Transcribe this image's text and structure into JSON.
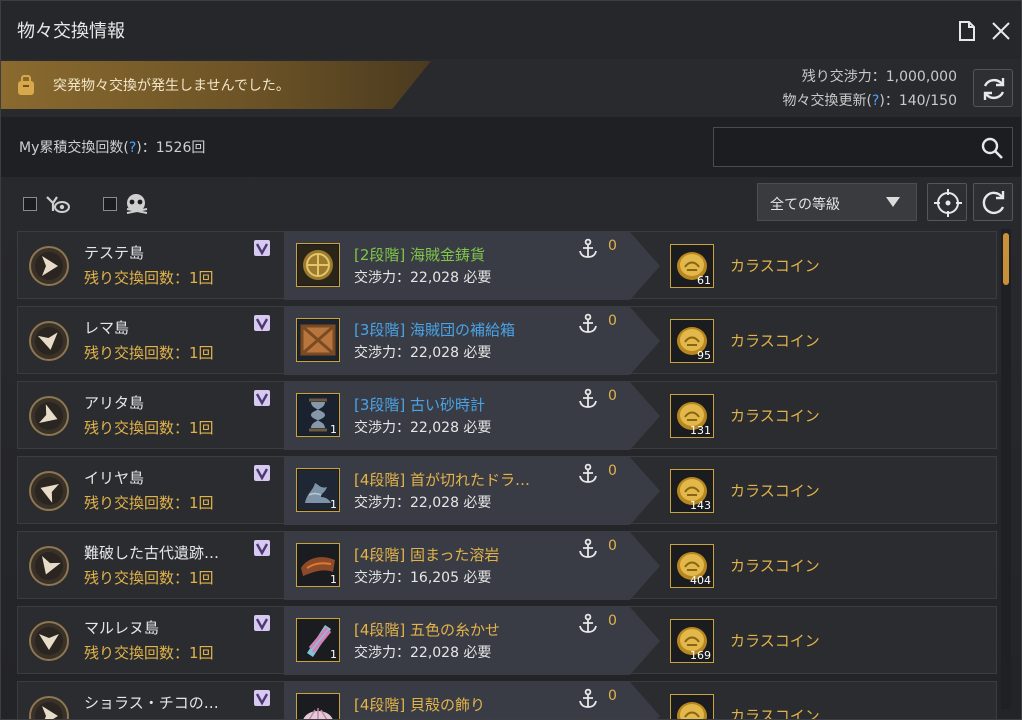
{
  "window": {
    "title": "物々交換情報",
    "banner_text": "突発物々交換が発生しませんでした。",
    "stats": {
      "remaining_power_label": "残り交渉力：",
      "remaining_power_value": "1,000,000",
      "refresh_label_pre": "物々交換更新(",
      "refresh_label_q": "?",
      "refresh_label_post": ")：",
      "refresh_value": "140/150"
    },
    "cumulative_pre": "My累積交換回数(",
    "cumulative_q": "?",
    "cumulative_post": ")：1526回",
    "search_placeholder": "",
    "grade_select": "全ての等級"
  },
  "rows": [
    {
      "island": "テステ島",
      "remaining": "残り交換回数：1回",
      "item_name": "[2段階] 海賊金鋳貨",
      "item_color": "#7fc64a",
      "cost": "交渉力：22,028 必要",
      "anchor_count": "0",
      "item_qty": "",
      "reward_name": "カラスコイン",
      "reward_qty": "61",
      "item_icon": "gold-coin-icon",
      "compass_dir": 0
    },
    {
      "island": "レマ島",
      "remaining": "残り交換回数：1回",
      "item_name": "[3段階] 海賊団の補給箱",
      "item_color": "#4aa3e6",
      "cost": "交渉力：22,028 必要",
      "anchor_count": "0",
      "item_qty": "",
      "reward_name": "カラスコイン",
      "reward_qty": "95",
      "item_icon": "crate-icon",
      "compass_dir": 80
    },
    {
      "island": "アリタ島",
      "remaining": "残り交換回数：1回",
      "item_name": "[3段階] 古い砂時計",
      "item_color": "#4aa3e6",
      "cost": "交渉力：22,028 必要",
      "anchor_count": "0",
      "item_qty": "1",
      "reward_name": "カラスコイン",
      "reward_qty": "131",
      "item_icon": "hourglass-icon",
      "compass_dir": 20
    },
    {
      "island": "イリヤ島",
      "remaining": "残り交換回数：1回",
      "item_name": "[4段階] 首が切れたドラ…",
      "item_color": "#e2b34a",
      "cost": "交渉力：22,028 必要",
      "anchor_count": "0",
      "item_qty": "1",
      "reward_name": "カラスコイン",
      "reward_qty": "143",
      "item_icon": "dragon-statue-icon",
      "compass_dir": 200
    },
    {
      "island": "難破した古代遺跡…",
      "remaining": "残り交換回数：1回",
      "item_name": "[4段階] 固まった溶岩",
      "item_color": "#e2b34a",
      "cost": "交渉力：16,205 必要",
      "anchor_count": "0",
      "item_qty": "1",
      "reward_name": "カラスコイン",
      "reward_qty": "404",
      "item_icon": "lava-rock-icon",
      "compass_dir": 110
    },
    {
      "island": "マルレヌ島",
      "remaining": "残り交換回数：1回",
      "item_name": "[4段階] 五色の糸かせ",
      "item_color": "#e2b34a",
      "cost": "交渉力：22,028 必要",
      "anchor_count": "0",
      "item_qty": "1",
      "reward_name": "カラスコイン",
      "reward_qty": "169",
      "item_icon": "thread-skein-icon",
      "compass_dir": 90
    },
    {
      "island": "ショラス・チコの…",
      "remaining": "",
      "item_name": "[4段階] 貝殻の飾り",
      "item_color": "#e2b34a",
      "cost": "",
      "anchor_count": "0",
      "item_qty": "",
      "reward_name": "カラスコイン",
      "reward_qty": "",
      "item_icon": "shell-ornament-icon",
      "compass_dir": 0
    }
  ],
  "colors": {
    "accent_gold": "#e2b34a",
    "tier2": "#7fc64a",
    "tier3": "#4aa3e6",
    "tier4": "#e2b34a"
  }
}
